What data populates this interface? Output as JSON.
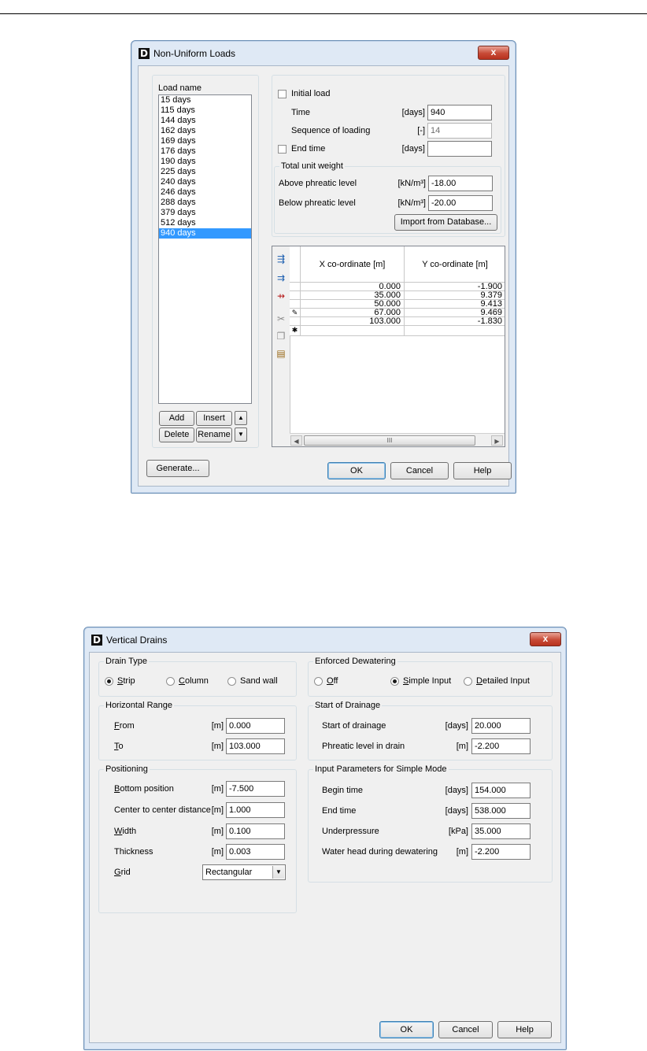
{
  "dialog1": {
    "title": "Non-Uniform Loads",
    "close_label": "x",
    "load_name_label": "Load name",
    "loads": [
      "15 days",
      "115 days",
      "144 days",
      "162 days",
      "169 days",
      "176 days",
      "190 days",
      "225 days",
      "240 days",
      "246 days",
      "288 days",
      "379 days",
      "512 days",
      "940 days"
    ],
    "selected_load": "940 days",
    "buttons": {
      "add": "Add",
      "insert": "Insert",
      "delete": "Delete",
      "rename": "Rename",
      "up": "▲",
      "down": "▼",
      "generate": "Generate...",
      "ok": "OK",
      "cancel": "Cancel",
      "help": "Help",
      "import_db": "Import from Database..."
    },
    "initial_load_label": "Initial load",
    "time_label": "Time",
    "time_unit": "[days]",
    "time_value": "940",
    "sequence_label": "Sequence of loading",
    "sequence_unit": "[-]",
    "sequence_value": "14",
    "end_time_label": "End time",
    "end_time_unit": "[days]",
    "end_time_value": "",
    "unit_weight_group": "Total unit weight",
    "above_label": "Above phreatic level",
    "above_unit": "[kN/m³]",
    "above_value": "-18.00",
    "below_label": "Below phreatic level",
    "below_unit": "[kN/m³]",
    "below_value": "-20.00",
    "table": {
      "col_x": "X co-ordinate [m]",
      "col_y": "Y co-ordinate [m]",
      "rows": [
        {
          "x": "0.000",
          "y": "-1.900"
        },
        {
          "x": "35.000",
          "y": "9.379"
        },
        {
          "x": "50.000",
          "y": "9.413"
        },
        {
          "x": "67.000",
          "y": "9.469"
        },
        {
          "x": "103.000",
          "y": "-1.830"
        }
      ],
      "new_row_marker": "✱",
      "edit_marker": "✎",
      "scroll_thumb_grip": "III",
      "scroll_left": "◀",
      "scroll_right": "▶"
    }
  },
  "dialog2": {
    "title": "Vertical Drains",
    "close_label": "x",
    "drain_type_group": "Drain Type",
    "drain_types": {
      "strip": "Strip",
      "column": "Column",
      "sand_wall": "Sand wall"
    },
    "drain_type_selected": "Strip",
    "horizontal_group": "Horizontal Range",
    "from_label": "From",
    "from_unit": "[m]",
    "from_value": "0.000",
    "to_label": "To",
    "to_unit": "[m]",
    "to_value": "103.000",
    "positioning_group": "Positioning",
    "bottom_label": "Bottom position",
    "bottom_unit": "[m]",
    "bottom_value": "-7.500",
    "ctc_label": "Center to center distance",
    "ctc_unit": "[m]",
    "ctc_value": "1.000",
    "width_label": "Width",
    "width_unit": "[m]",
    "width_value": "0.100",
    "thickness_label": "Thickness",
    "thickness_unit": "[m]",
    "thickness_value": "0.003",
    "grid_label": "Grid",
    "grid_value": "Rectangular",
    "dewatering_group": "Enforced Dewatering",
    "dewatering": {
      "off": "Off",
      "simple": "Simple Input",
      "detailed": "Detailed Input"
    },
    "dewatering_selected": "Simple Input",
    "start_group": "Start of Drainage",
    "start_label": "Start of drainage",
    "start_unit": "[days]",
    "start_value": "20.000",
    "phreatic_label": "Phreatic level in drain",
    "phreatic_unit": "[m]",
    "phreatic_value": "-2.200",
    "simple_group": "Input Parameters for Simple Mode",
    "begin_label": "Begin time",
    "begin_unit": "[days]",
    "begin_value": "154.000",
    "end_label": "End time",
    "end_unit": "[days]",
    "end_value": "538.000",
    "under_label": "Underpressure",
    "under_unit": "[kPa]",
    "under_value": "35.000",
    "head_label": "Water head during dewatering",
    "head_unit": "[m]",
    "head_value": "-2.200",
    "buttons": {
      "ok": "OK",
      "cancel": "Cancel",
      "help": "Help"
    }
  },
  "icons": {
    "app": "D",
    "dropdown": "▼"
  }
}
